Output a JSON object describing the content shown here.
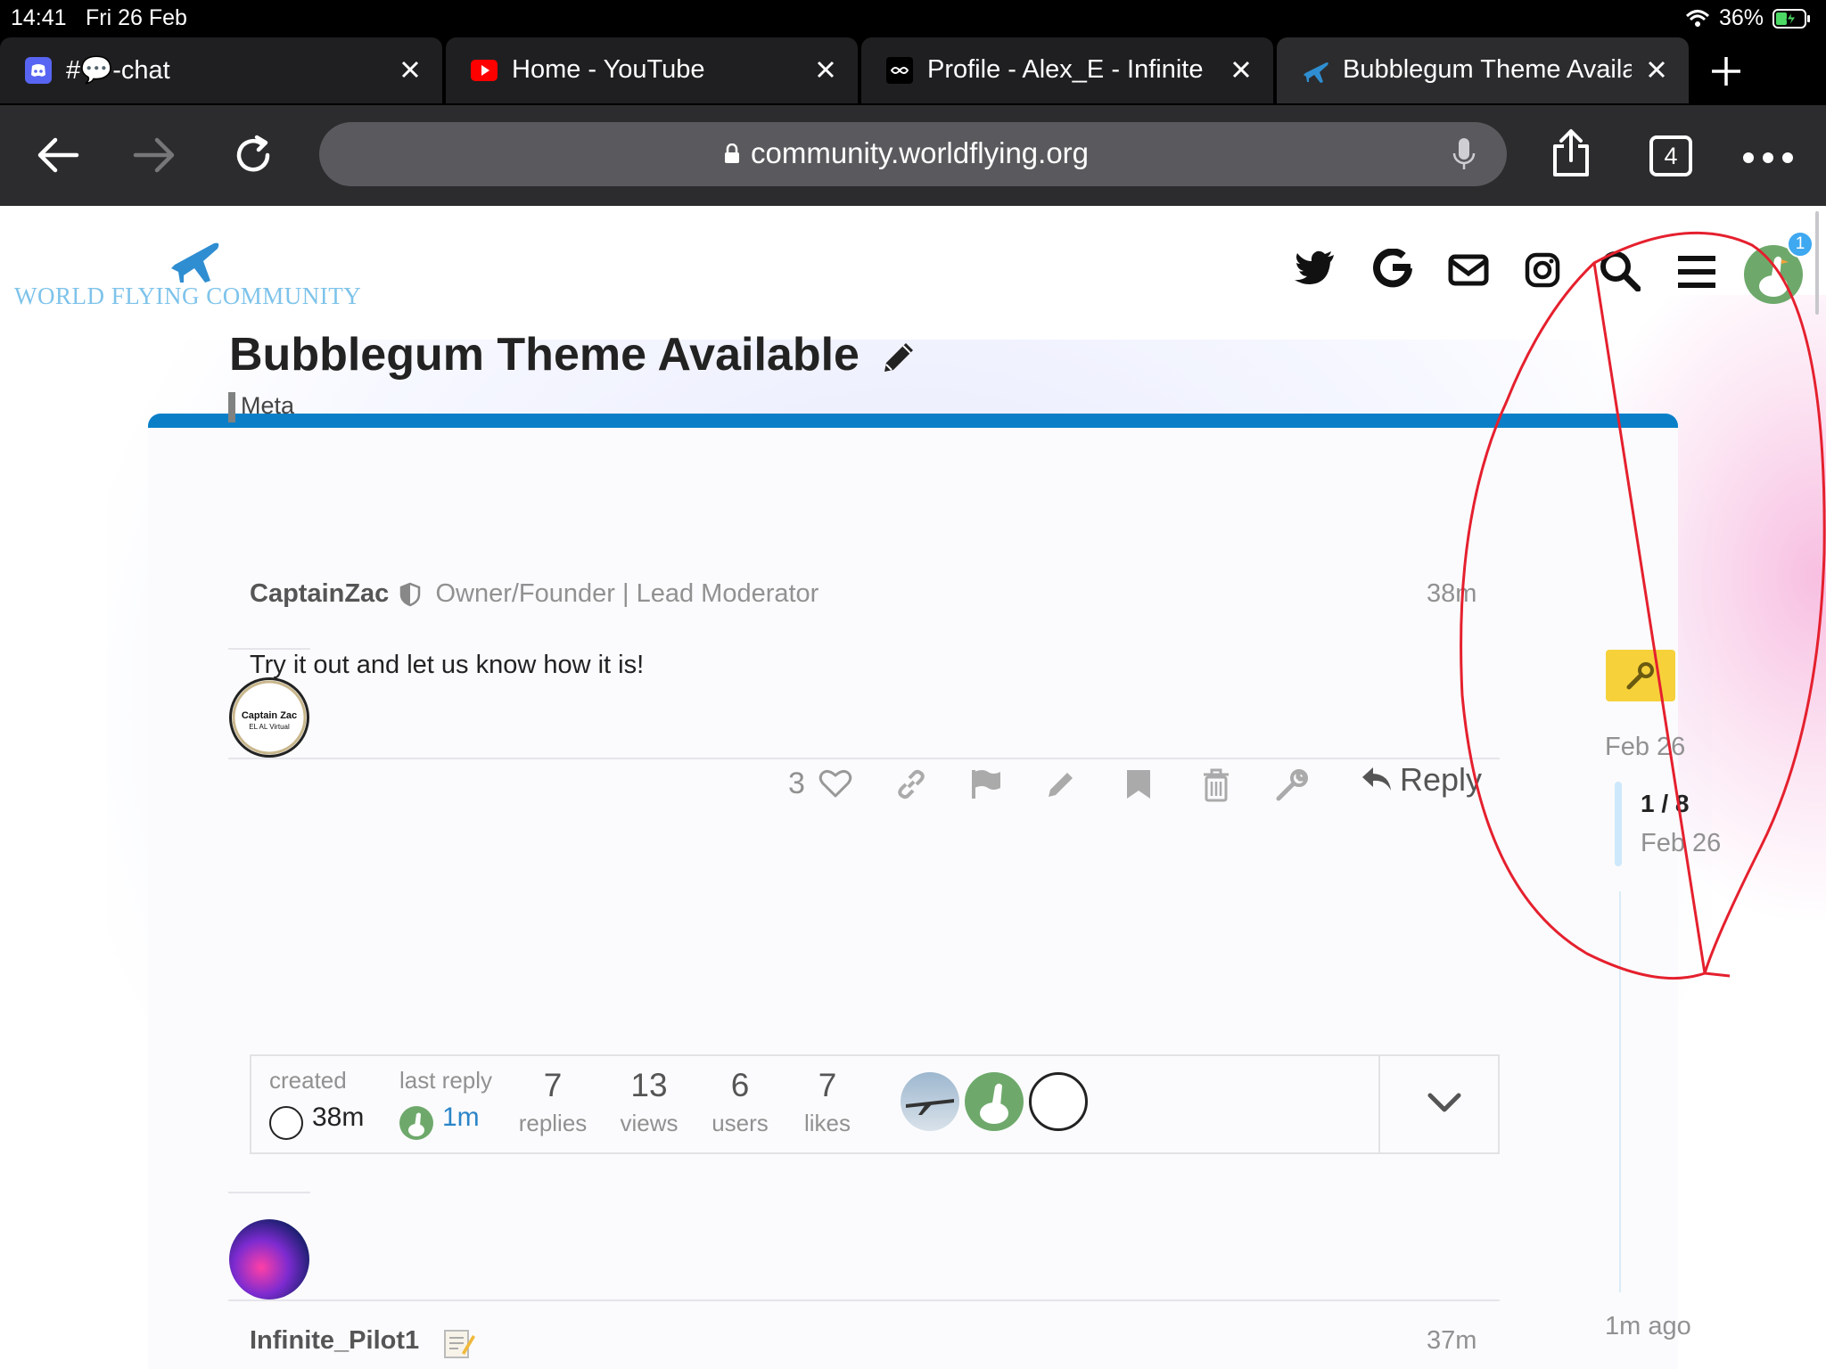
{
  "status_bar": {
    "time": "14:41",
    "date": "Fri 26 Feb",
    "battery": "36%"
  },
  "tabs": [
    {
      "title": "#💬-chat",
      "icon": "discord-icon"
    },
    {
      "title": "Home - YouTube",
      "icon": "youtube-icon"
    },
    {
      "title": "Profile - Alex_E - Infinite",
      "icon": "infinite-flight-icon"
    },
    {
      "title": "Bubblegum Theme Available",
      "icon": "world-flying-plane-icon"
    }
  ],
  "toolbar": {
    "url": "community.worldflying.org",
    "tab_count": "4"
  },
  "site": {
    "logo_text": "WORLD FLYING COMMUNITY",
    "notification_count": "1",
    "header_icons": [
      "twitter-icon",
      "google-icon",
      "mail-icon",
      "instagram-icon",
      "search-icon",
      "hamburger-menu-icon",
      "user-avatar"
    ]
  },
  "topic": {
    "title": "Bubblegum Theme Available",
    "category": "Meta"
  },
  "post1": {
    "avatar_text": "Captain Zac",
    "avatar_subtext": "EL AL Virtual",
    "username": "CaptainZac",
    "user_title": "Owner/Founder | Lead Moderator",
    "time": "38m",
    "body": "Try it out and let us know how it is!",
    "likes": "3",
    "reply_label": "Reply"
  },
  "topic_map": {
    "created_label": "created",
    "created_time": "38m",
    "last_reply_label": "last reply",
    "last_reply_time": "1m",
    "replies": "7",
    "replies_label": "replies",
    "views": "13",
    "views_label": "views",
    "users": "6",
    "users_label": "users",
    "likes": "7",
    "likes_label": "likes"
  },
  "post2": {
    "username": "Infinite_Pilot1",
    "time": "37m"
  },
  "timeline": {
    "start_date": "Feb 26",
    "position": "1 / 8",
    "position_date": "Feb 26",
    "end_label": "1m ago"
  },
  "colors": {
    "brand_blue": "#0a7fc8",
    "logo_blue": "#7ec3ea",
    "admin_yellow": "#f6d13a",
    "annotation_red": "#e5202e",
    "toolbar": "#2c2c2e"
  }
}
